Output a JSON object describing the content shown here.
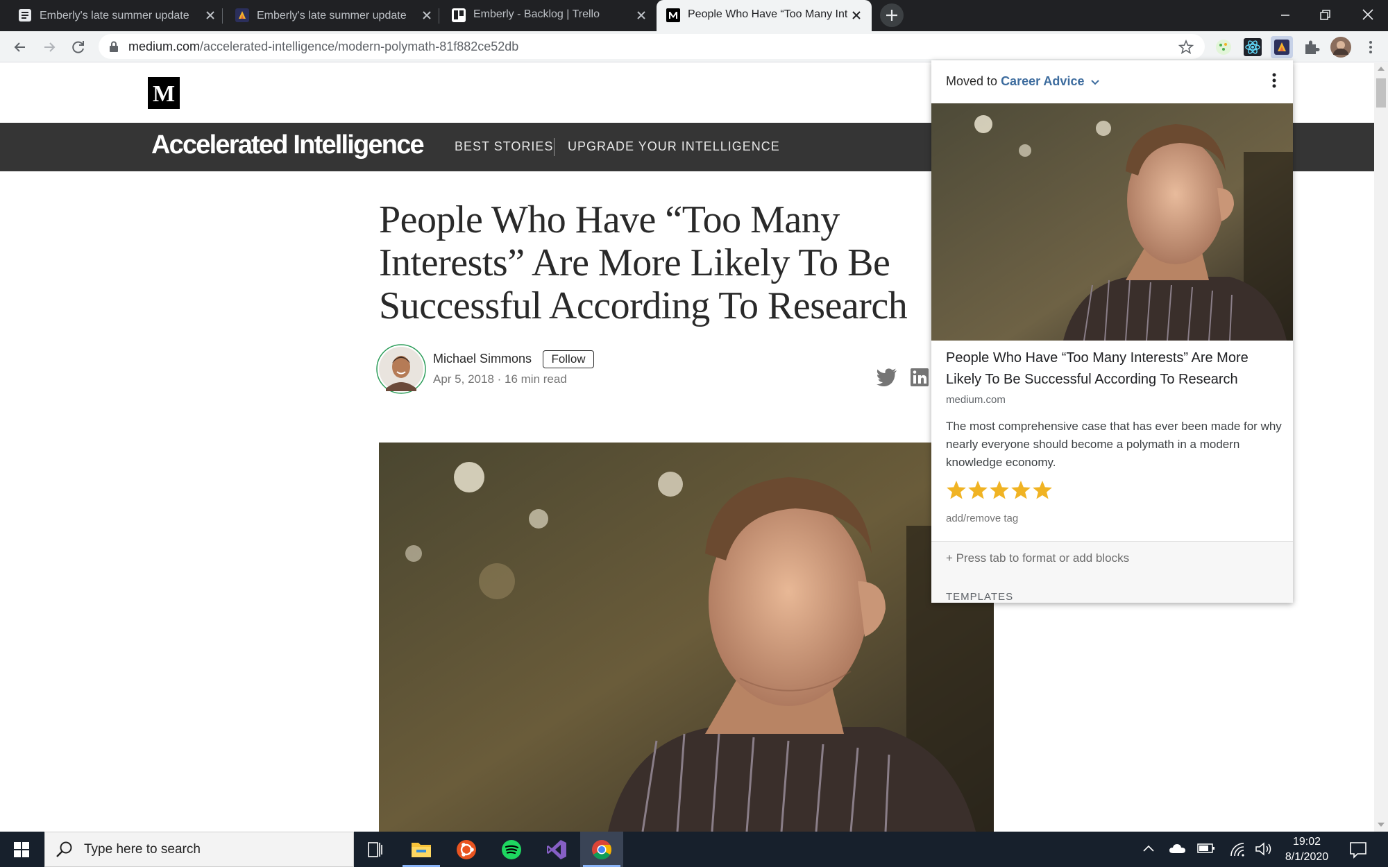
{
  "browser": {
    "tabs": [
      {
        "title": "Emberly's late summer update 🌴",
        "favicon": "document-icon"
      },
      {
        "title": "Emberly's late summer update 🌴",
        "favicon": "emberly-icon"
      },
      {
        "title": "Emberly - Backlog | Trello",
        "favicon": "trello-icon"
      },
      {
        "title": "People Who Have “Too Many Inte",
        "favicon": "medium-icon",
        "active": true
      }
    ],
    "url_domain": "medium.com",
    "url_path": "/accelerated-intelligence/modern-polymath-81f882ce52db"
  },
  "medium": {
    "logo": "M",
    "publication": "Accelerated Intelligence",
    "nav": [
      "BEST STORIES",
      "UPGRADE YOUR INTELLIGENCE"
    ],
    "article": {
      "title": "People Who Have “Too Many Interests” Are More Likely To Be Successful According To Research",
      "author": "Michael Simmons",
      "follow": "Follow",
      "meta": "Apr 5, 2018 · 16 min read"
    }
  },
  "popup": {
    "moved_prefix": "Moved to",
    "category": "Career Advice",
    "title": "People Who Have “Too Many Interests” Are More Likely To Be Successful According To Research",
    "domain": "medium.com",
    "description": "The most comprehensive case that has ever been made for why nearly everyone should become a polymath in a modern knowledge economy.",
    "rating": 5,
    "tag_link": "add/remove tag",
    "hint": "+ Press tab to format or add blocks",
    "templates": "TEMPLATES",
    "star_color": "#f0b323"
  },
  "taskbar": {
    "search_placeholder": "Type here to search",
    "time": "19:02",
    "date": "8/1/2020"
  }
}
